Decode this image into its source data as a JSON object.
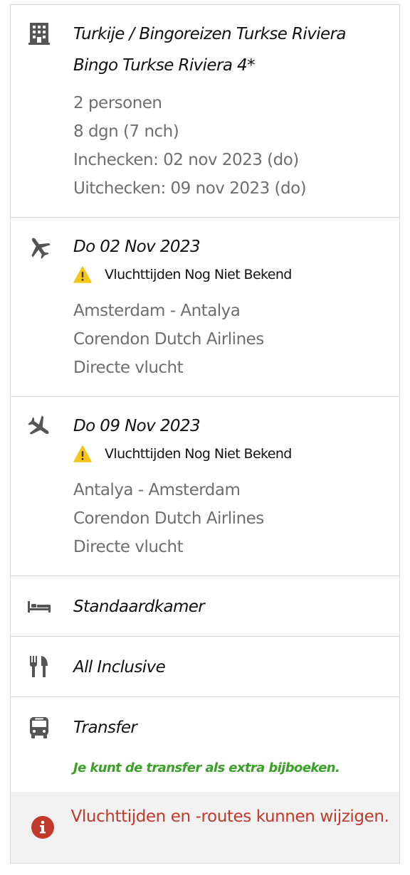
{
  "accommodation": {
    "icon": "building-icon",
    "title_line1": "Turkije  /  Bingoreizen Turkse Riviera",
    "title_line2": "Bingo Turkse Riviera 4*",
    "persons": "2 personen",
    "duration": "8 dgn (7 nch)",
    "checkin": "Inchecken: 02 nov 2023 (do)",
    "checkout": "Uitchecken: 09 nov 2023 (do)"
  },
  "outbound_flight": {
    "icon": "plane-departure-icon",
    "date": "Do 02 Nov 2023",
    "warning_icon": "warning-icon",
    "warning": "Vluchttijden Nog Niet Bekend",
    "route": "Amsterdam - Antalya",
    "airline": "Corendon Dutch Airlines",
    "type": "Directe vlucht"
  },
  "return_flight": {
    "icon": "plane-return-icon",
    "date": "Do 09 Nov 2023",
    "warning_icon": "warning-icon",
    "warning": "Vluchttijden Nog Niet Bekend",
    "route": "Antalya - Amsterdam",
    "airline": "Corendon Dutch Airlines",
    "type": "Directe vlucht"
  },
  "room": {
    "icon": "bed-icon",
    "label": "Standaardkamer"
  },
  "board": {
    "icon": "fork-knife-icon",
    "label": "All Inclusive"
  },
  "transfer": {
    "icon": "bus-icon",
    "label": "Transfer",
    "note": "Je kunt de transfer als extra bijboeken."
  },
  "notice": {
    "icon": "info-icon",
    "text": "Vluchttijden en -routes kunnen wijzigen."
  },
  "colors": {
    "icon_gray": "#555555",
    "text_gray": "#6e6e6e",
    "warning_yellow": "#f5c518",
    "green": "#3aa028",
    "alert_red": "#c0392b",
    "notice_bg": "#f1f1f1",
    "border": "#d7d7d7"
  }
}
